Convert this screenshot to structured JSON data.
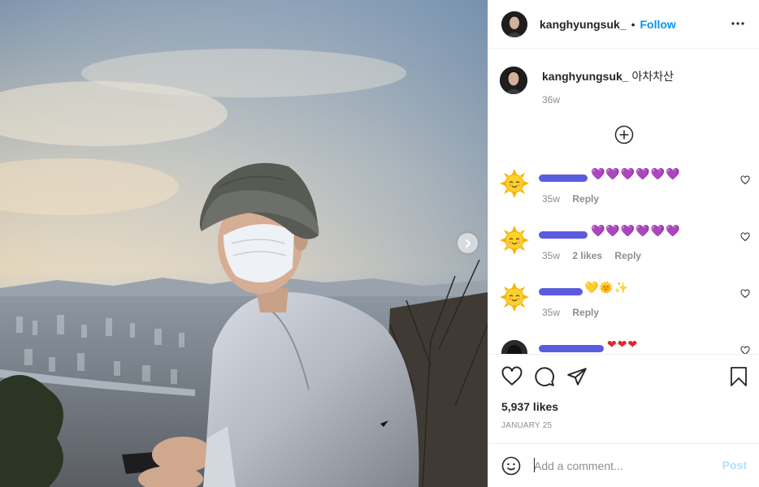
{
  "header": {
    "username": "kanghyungsuk_",
    "separator": "•",
    "follow_label": "Follow"
  },
  "caption": {
    "username": "kanghyungsuk_",
    "text": "아차차산",
    "time": "36w"
  },
  "comments": [
    {
      "emojis": "💜💜💜💜💜💜",
      "time": "35w",
      "likes": "",
      "reply": "Reply"
    },
    {
      "emojis": "💜💜💜💜💜💜",
      "time": "35w",
      "likes": "2 likes",
      "reply": "Reply"
    },
    {
      "emojis": "💛🌞✨",
      "time": "35w",
      "likes": "",
      "reply": "Reply"
    },
    {
      "emojis": "❤❤❤",
      "time": "",
      "likes": "",
      "reply": ""
    }
  ],
  "post": {
    "likes": "5,937 likes",
    "date": "JANUARY 25"
  },
  "add_comment": {
    "placeholder": "Add a comment...",
    "post_label": "Post"
  },
  "icons": {
    "more": "more-options-icon",
    "next": "chevron-right-icon",
    "load_more": "plus-circle-icon",
    "like": "heart-icon",
    "comment": "comment-icon",
    "share": "paper-plane-icon",
    "save": "bookmark-icon",
    "emoji": "smiley-icon"
  },
  "colors": {
    "accent": "#0095f6",
    "muted": "#8e8e8e",
    "post_disabled": "#b2dffc"
  }
}
